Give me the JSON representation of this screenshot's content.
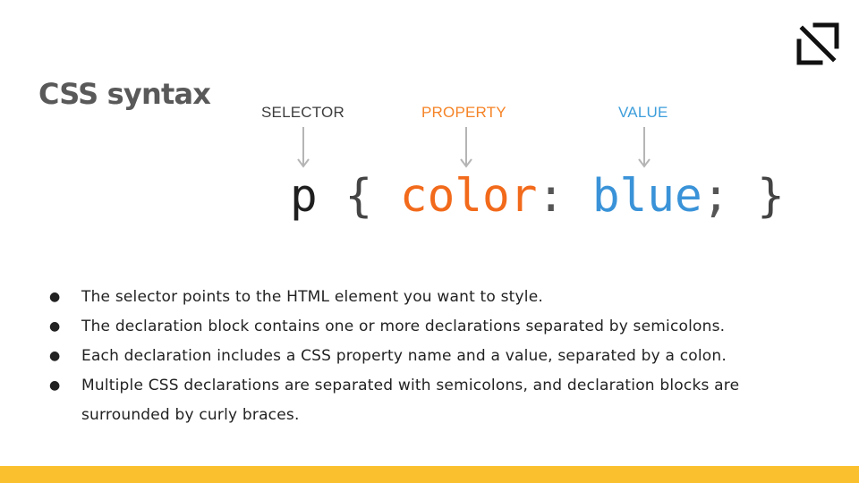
{
  "slide": {
    "title": "CSS syntax"
  },
  "logo": {
    "icon": "brand-logo-icon",
    "color": "#111111"
  },
  "diagram": {
    "labels": {
      "selector": "SELECTOR",
      "property": "PROPERTY",
      "value": "VALUE"
    },
    "code": {
      "selector": "p",
      "open_brace": "{",
      "property": "color",
      "colon": ":",
      "value": "blue",
      "semicolon": ";",
      "close_brace": "}"
    },
    "colors": {
      "selector": "#3d3d3d",
      "property": "#f26a1b",
      "value": "#3a93d8",
      "arrow": "#b5b5b5"
    }
  },
  "bullets": [
    "The selector points to the HTML element you want to style.",
    "The declaration block contains one or more declarations separated by semicolons.",
    "Each declaration includes a CSS property name and a value, separated by a colon.",
    "Multiple CSS declarations are separated with semicolons, and declaration blocks are surrounded by curly braces."
  ],
  "bullet_glyph": "●",
  "footer": {
    "color": "#fbc02d"
  }
}
